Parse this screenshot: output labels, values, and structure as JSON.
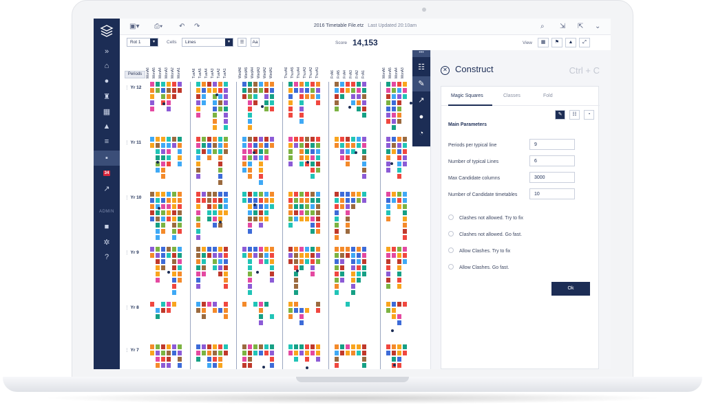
{
  "app": {
    "file_title": "2016 Timetable File.etz",
    "last_updated": "Last Updated 20:10am"
  },
  "toolbar": {
    "rot_select": "Rot 1",
    "cells_label": "Cells",
    "cells_select": "Lines",
    "aa_label": "Aa",
    "score_label": "Score",
    "score_value": "14,153",
    "view_label": "View"
  },
  "rail": {
    "admin_label": "ADMIN",
    "badge": "34",
    "expand_glyph": "»"
  },
  "grid": {
    "periods_button": "Periods",
    "days": [
      [
        "MonA6",
        "MonA5",
        "MonA4",
        "MonA3",
        "MonA2",
        "MonA1"
      ],
      [
        "TueA6",
        "TueA5",
        "TueA4",
        "TueA3",
        "TueA2",
        "TueA1"
      ],
      [
        "WedA6",
        "WedA5",
        "WedA4",
        "WedA3",
        "WedA2",
        "WedA1"
      ],
      [
        "ThurA6",
        "ThurA5",
        "ThurA4",
        "ThurA3",
        "ThurA2",
        "ThurA1"
      ],
      [
        "FriA6",
        "FriA5",
        "FriA4",
        "FriA3",
        "FriA2",
        "FriA1"
      ],
      [
        "MonA6",
        "MonA5",
        "MonA4",
        "MonA3"
      ]
    ],
    "years": [
      "Yr 12",
      "Yr 11",
      "Yr 10",
      "Yr 9",
      "Yr 8",
      "Yr 7"
    ],
    "colors": [
      "#f0473f",
      "#f48a2a",
      "#f9a51e",
      "#21c4b7",
      "#3fa9f5",
      "#8c5bd6",
      "#e449a1",
      "#7cb342",
      "#9b6a3f",
      "#3d6bd8",
      "#16a085",
      "#c0392b"
    ]
  },
  "panel": {
    "title": "Construct",
    "shortcut": "Ctrl + C",
    "tabs": [
      "Magic Squares",
      "Classes",
      "Fold"
    ],
    "section": "Main Parameters",
    "fields": [
      {
        "label": "Periods per typical line",
        "value": "9"
      },
      {
        "label": "Number of typical Lines",
        "value": "6"
      },
      {
        "label": "Max Candidate columns",
        "value": "3000"
      },
      {
        "label": "Number of Candidate timetables",
        "value": "10"
      }
    ],
    "options": [
      "Clashes not allowed. Try to fix",
      "Clashes not allowed. Go fast.",
      "Allow Clashes. Try to fix",
      "Allow Clashes. Go fast."
    ],
    "ok_label": "Ok"
  }
}
